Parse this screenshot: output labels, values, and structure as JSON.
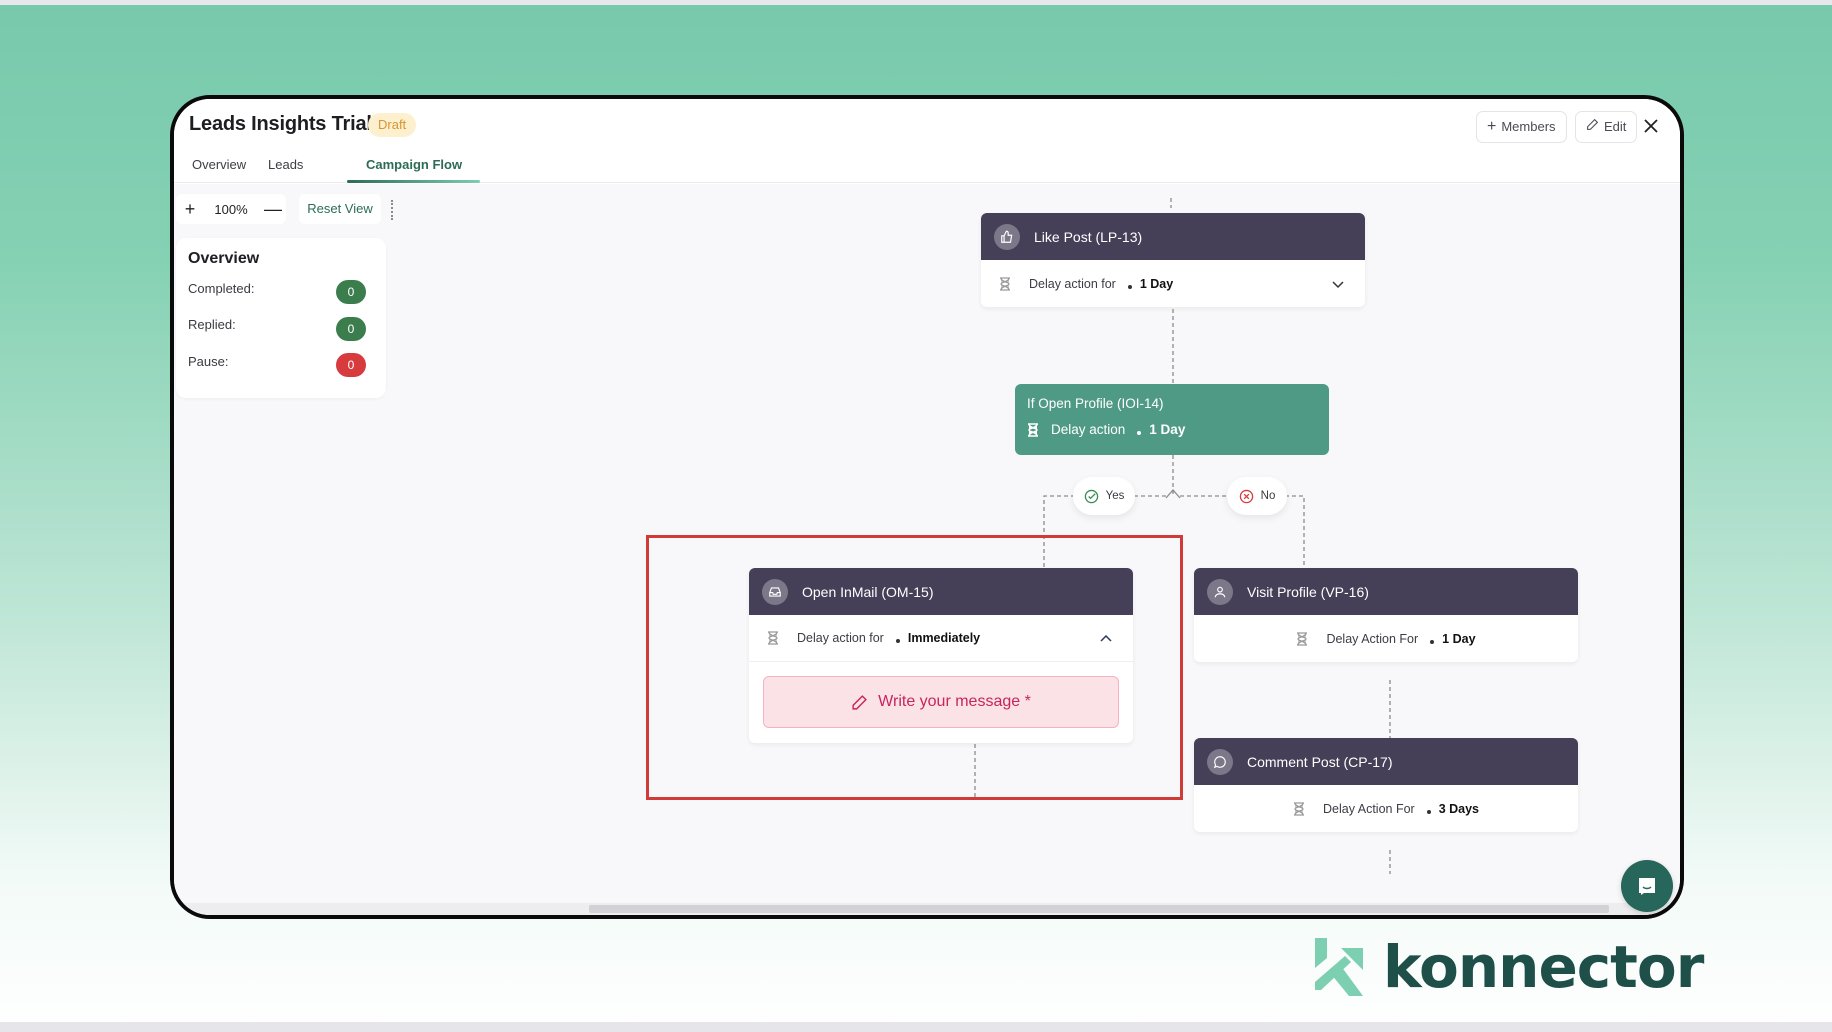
{
  "window": {
    "title": "Leads Insights Trial",
    "status_badge": "Draft"
  },
  "header": {
    "members_button": "Members",
    "edit_button": "Edit",
    "close_icon": "close-icon"
  },
  "tabs": [
    {
      "label": "Overview",
      "active": false
    },
    {
      "label": "Leads",
      "active": false
    },
    {
      "label": "Campaign Flow",
      "active": true
    }
  ],
  "toolbar": {
    "zoom_in": "+",
    "zoom_level": "100%",
    "zoom_out": "—",
    "reset_view": "Reset View"
  },
  "overview": {
    "title": "Overview",
    "rows": [
      {
        "label": "Completed:",
        "value": "0",
        "color": "#3c7d4e"
      },
      {
        "label": "Replied:",
        "value": "0",
        "color": "#3c7d4e"
      },
      {
        "label": "Pause:",
        "value": "0",
        "color": "#d63b3e"
      }
    ]
  },
  "flow": {
    "like_post": {
      "title": "Like Post (LP-13)",
      "icon": "thumbs-up-icon",
      "delay_label": "Delay action for",
      "delay_value": "1 Day",
      "expanded": false
    },
    "if_open_profile": {
      "title": "If Open Profile (IOI-14)",
      "delay_label": "Delay action",
      "delay_value": "1 Day"
    },
    "branch_yes": "Yes",
    "branch_no": "No",
    "open_inmail": {
      "title": "Open InMail (OM-15)",
      "icon": "inbox-icon",
      "delay_label": "Delay action for",
      "delay_value": "Immediately",
      "expanded": true,
      "message_button": "Write your message *"
    },
    "visit_profile": {
      "title": "Visit Profile (VP-16)",
      "icon": "user-icon",
      "delay_label": "Delay Action For",
      "delay_value": "1 Day"
    },
    "comment_post": {
      "title": "Comment Post (CP-17)",
      "icon": "comment-icon",
      "delay_label": "Delay Action For",
      "delay_value": "3 Days"
    }
  },
  "brand": {
    "name": "konnector",
    "primary": "#1f4f49",
    "accent": "#7ccfb1"
  },
  "colors": {
    "node_header": "#463f58",
    "condition_node": "#4f9a84",
    "highlight": "#d13b37"
  }
}
